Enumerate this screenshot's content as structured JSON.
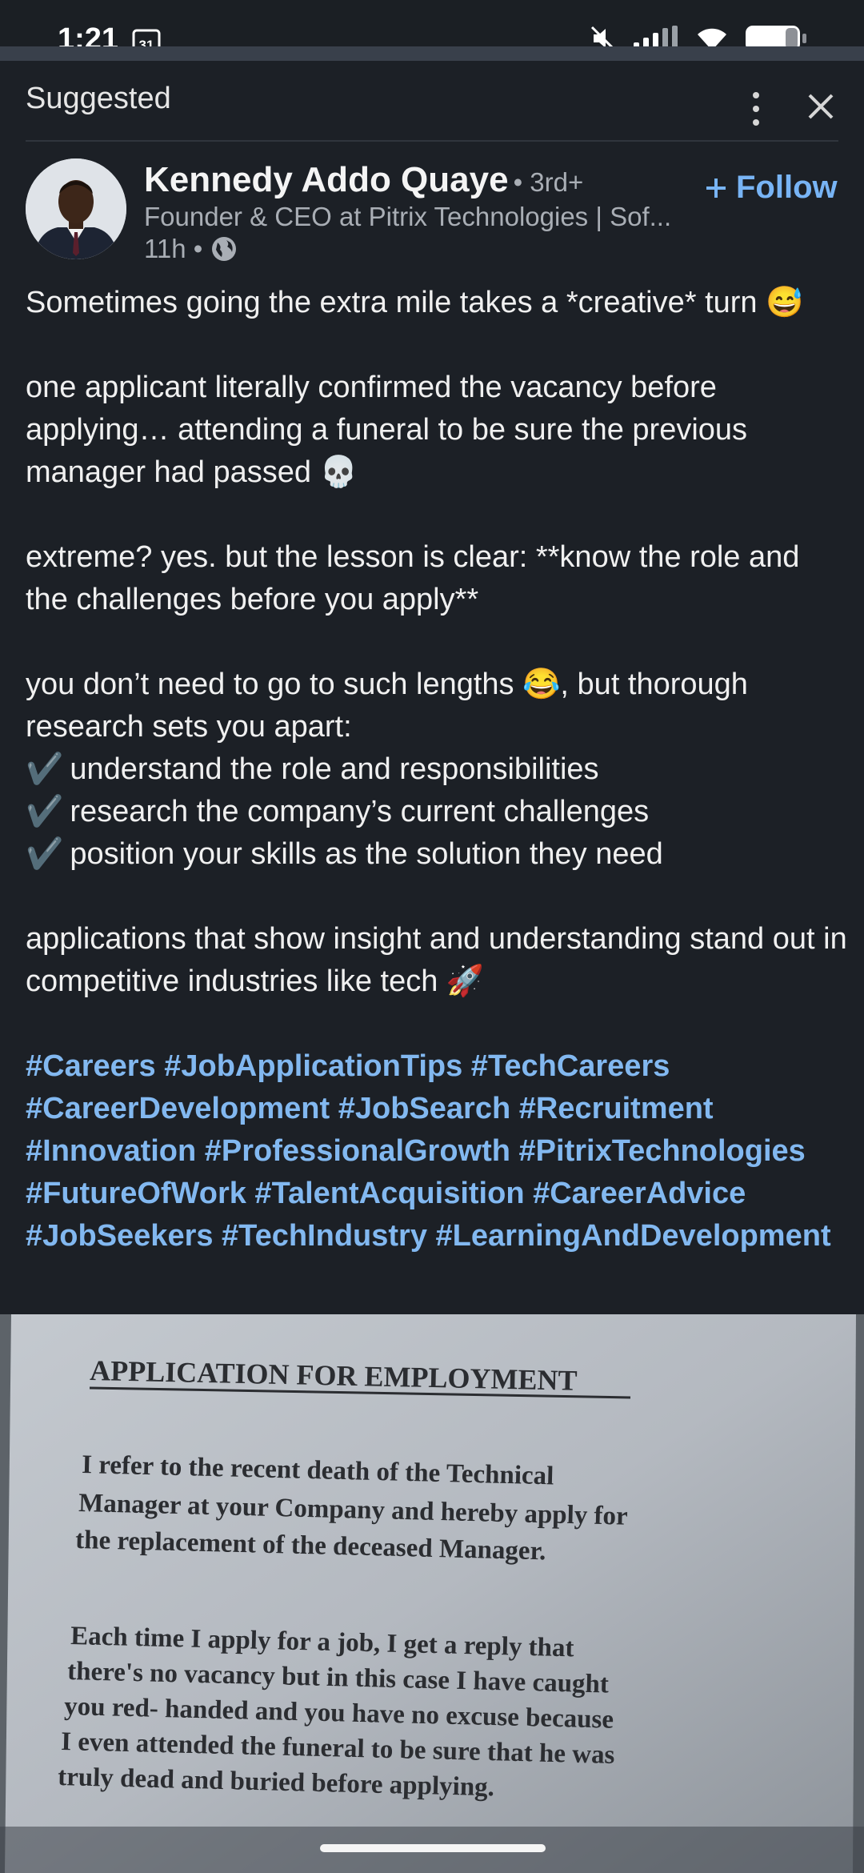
{
  "status": {
    "time": "1:21",
    "calendar_day": "31"
  },
  "header": {
    "title": "Suggested"
  },
  "author": {
    "name": "Kennedy Addo Quaye",
    "degree": "• 3rd+",
    "title": "Founder & CEO at Pitrix Technologies | Sof...",
    "time_ago": "11h •",
    "follow_label": "Follow"
  },
  "post": {
    "line1": "Sometimes going the extra mile takes a *creative* turn 😅",
    "line2": "one applicant literally confirmed the vacancy before applying… attending a funeral to be sure the previous manager had passed 💀",
    "line3": "extreme? yes. but the lesson is clear: **know the role and the challenges before you apply**",
    "line4": "you don’t need to go to such lengths 😂, but thorough research sets you apart:",
    "check1": "understand the role and responsibilities",
    "check2": "research the company’s current challenges",
    "check3": "position your skills as the solution they need",
    "line5": "applications that show insight and understanding stand out in competitive industries like tech 🚀",
    "hashtags": "#Careers #JobApplicationTips #TechCareers #CareerDevelopment #JobSearch #Recruitment #Innovation #ProfessionalGrowth #PitrixTechnologies #FutureOfWork #TalentAcquisition #CareerAdvice #JobSeekers #TechIndustry #LearningAndDevelopment"
  },
  "photo": {
    "heading": "APPLICATION FOR EMPLOYMENT",
    "para1": [
      "I refer to the recent death of the Technical",
      "Manager at your Company and hereby apply for",
      "the replacement of the deceased Manager."
    ],
    "para2": [
      "Each time I apply for a job, I get a reply that",
      "there's no vacancy but in this case I have caught",
      "you red- handed and you have no excuse because",
      "I even attended the funeral to be sure that he was",
      "truly dead and buried before applying."
    ]
  },
  "colors": {
    "link": "#78b4f5",
    "background": "#1c2026",
    "hashtag": "#82b8f0"
  }
}
